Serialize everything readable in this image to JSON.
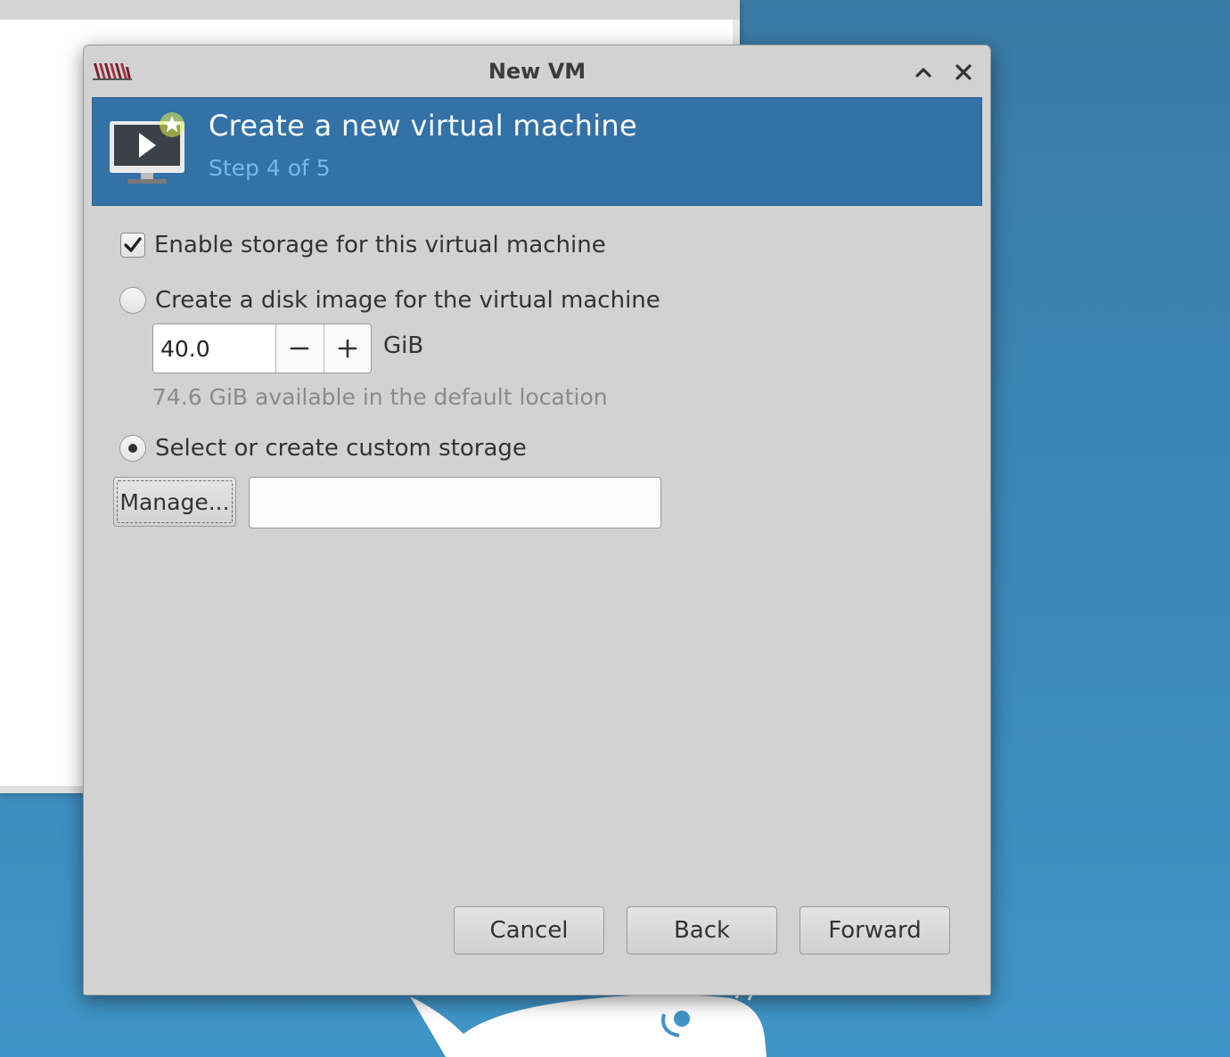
{
  "dialog": {
    "title": "New VM"
  },
  "banner": {
    "title": "Create a new virtual machine",
    "step": "Step 4 of 5"
  },
  "storage": {
    "enable_label": "Enable storage for this virtual machine",
    "enable_checked": true,
    "create_disk_label": "Create a disk image for the virtual machine",
    "create_disk_selected": false,
    "disk_size_value": "40.0",
    "disk_size_unit": "GiB",
    "available_hint": "74.6 GiB available in the default location",
    "custom_label": "Select or create custom storage",
    "custom_selected": true,
    "manage_button": "Manage...",
    "custom_path_value": ""
  },
  "footer": {
    "cancel": "Cancel",
    "back": "Back",
    "forward": "Forward"
  },
  "icons": {
    "app_logo": "virt-manager-logo",
    "minimize": "chevron-up-icon",
    "close": "close-icon",
    "banner": "monitor-play-new-icon"
  },
  "colors": {
    "banner_bg": "#3371a6",
    "banner_step": "#78b7e8",
    "dialog_bg": "#d2d2d2",
    "desktop_bg": "#3b86b5"
  }
}
